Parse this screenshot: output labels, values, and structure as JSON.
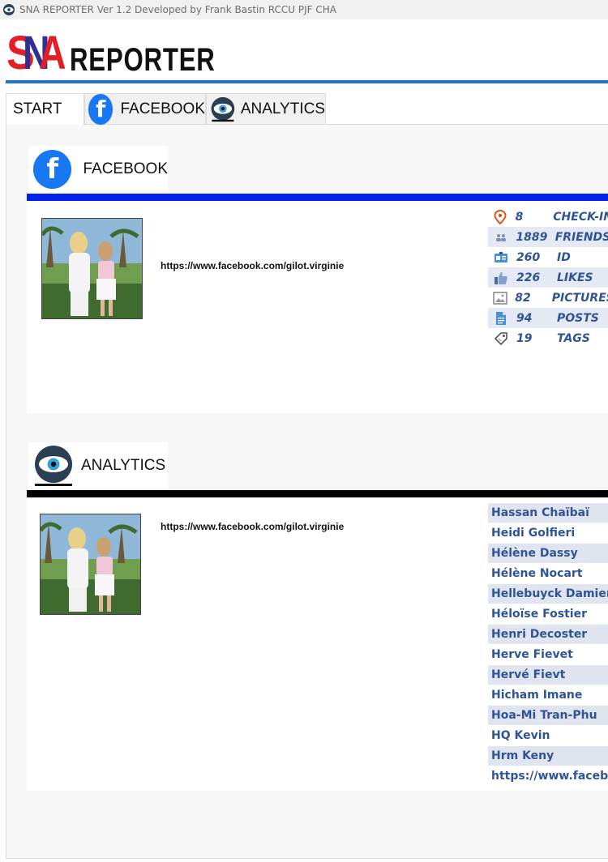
{
  "window": {
    "title": "SNA REPORTER Ver 1.2 Developed by Frank Bastin RCCU PJF CHA",
    "app_icon": "eye-icon"
  },
  "logo": {
    "letter_s": "S",
    "letter_n": "N",
    "letter_a": "A",
    "reporter": "REPORTER",
    "colors": {
      "red": "#e21f26",
      "blue": "#2e3192"
    }
  },
  "tabs": [
    {
      "label": "START",
      "active": true
    },
    {
      "label": "FACEBOOK",
      "icon": "facebook-icon"
    },
    {
      "label": "ANALYTICS",
      "icon": "eye-icon"
    }
  ],
  "facebook_section": {
    "title": "FACEBOOK",
    "icon": "facebook-icon",
    "bar_color": "#0022ee",
    "profile_url": "https://www.facebook.com/gilot.virginie",
    "stats": [
      {
        "icon": "location-pin-icon",
        "value": "8",
        "label": "CHECK-IN"
      },
      {
        "icon": "friends-icon",
        "value": "1889",
        "label": "FRIENDS"
      },
      {
        "icon": "id-card-icon",
        "value": "260",
        "label": "ID"
      },
      {
        "icon": "thumbs-up-icon",
        "value": "226",
        "label": "LIKES"
      },
      {
        "icon": "picture-icon",
        "value": "82",
        "label": "PICTURES"
      },
      {
        "icon": "document-icon",
        "value": "94",
        "label": "POSTS"
      },
      {
        "icon": "tag-icon",
        "value": "19",
        "label": "TAGS"
      }
    ]
  },
  "analytics_section": {
    "title": "ANALYTICS",
    "icon": "eye-icon",
    "bar_color": "#000000",
    "profile_url": "https://www.facebook.com/gilot.virginie",
    "names": [
      "Hassan Chaïbaï",
      "Heidi Golfieri",
      "Hélène Dassy",
      "Hélène Nocart",
      "Hellebuyck Damien",
      "Héloïse Fostier",
      "Henri Decoster",
      "Herve Fievet",
      "Hervé Fievt",
      "Hicham Imane",
      "Hoa-Mi Tran-Phu",
      "HQ Kevin",
      "Hrm Keny",
      "https://www.facebook.com"
    ]
  },
  "accent_color": "#1e73d8",
  "text_color": "#2f5496"
}
